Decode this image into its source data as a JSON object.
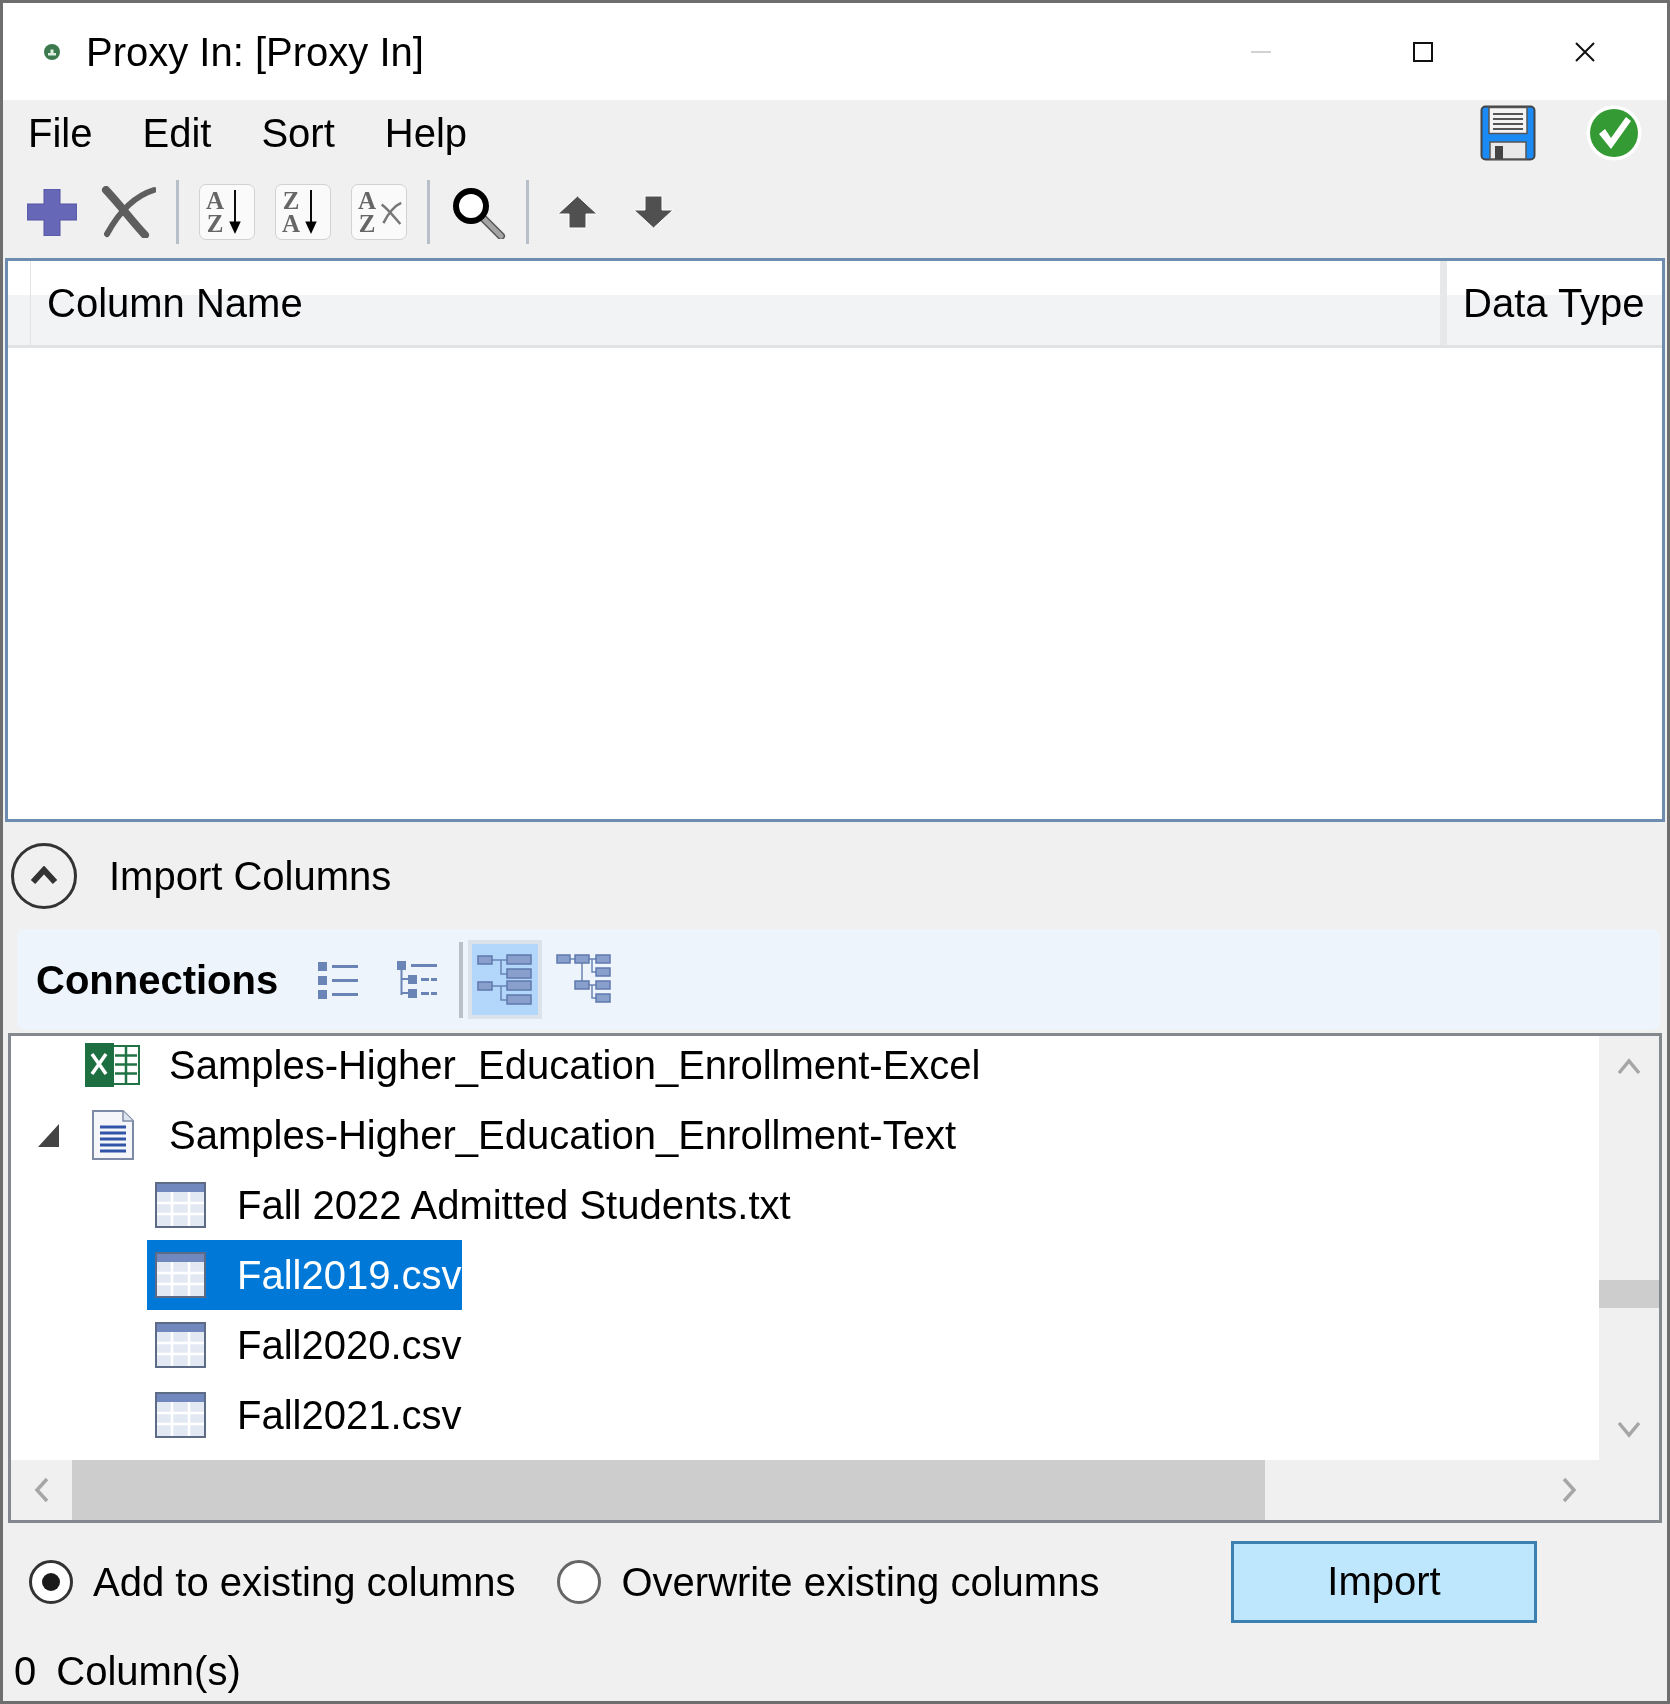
{
  "window": {
    "title": "Proxy In: [Proxy In]",
    "controls": [
      {
        "kind": "minimize",
        "disabled": true
      },
      {
        "kind": "maximize",
        "disabled": false
      },
      {
        "kind": "close",
        "disabled": false
      }
    ]
  },
  "menu": {
    "items": [
      "File",
      "Edit",
      "Sort",
      "Help"
    ],
    "actions": [
      {
        "kind": "save"
      },
      {
        "kind": "apply"
      }
    ]
  },
  "toolbar": [
    {
      "kind": "add"
    },
    {
      "kind": "delete"
    },
    {
      "kind": "separator"
    },
    {
      "kind": "sort",
      "letters": [
        "A",
        "Z"
      ]
    },
    {
      "kind": "sort",
      "letters": [
        "Z",
        "A"
      ]
    },
    {
      "kind": "clear_sort",
      "letters": [
        "A",
        "Z"
      ]
    },
    {
      "kind": "separator"
    },
    {
      "kind": "search"
    },
    {
      "kind": "separator"
    },
    {
      "kind": "move_up"
    },
    {
      "kind": "move_down"
    }
  ],
  "table": {
    "columns": [
      "Column Name",
      "Data Type"
    ]
  },
  "import_section": {
    "title": "Import Columns",
    "expanded": true
  },
  "connections": {
    "title": "Connections",
    "views": [
      {
        "kind": "list",
        "selected": false
      },
      {
        "kind": "indented_list",
        "selected": false
      },
      {
        "kind": "separator"
      },
      {
        "kind": "tree",
        "selected": true
      },
      {
        "kind": "tree_compact",
        "selected": false
      }
    ],
    "tree": [
      {
        "label": "Samples-Higher_Education_Enrollment-Excel",
        "kind": "excel",
        "selected": false
      },
      {
        "label": "Samples-Higher_Education_Enrollment-Text",
        "kind": "text",
        "selected": false,
        "expanded": true,
        "children": [
          {
            "label": "Fall 2022 Admitted Students.txt",
            "kind": "table",
            "selected": false
          },
          {
            "label": "Fall2019.csv",
            "kind": "table",
            "selected": true
          },
          {
            "label": "Fall2020.csv",
            "kind": "table",
            "selected": false
          },
          {
            "label": "Fall2021.csv",
            "kind": "table",
            "selected": false
          }
        ]
      }
    ]
  },
  "import_options": [
    {
      "label": "Add to existing columns",
      "selected": true
    },
    {
      "label": "Overwrite existing columns",
      "selected": false
    }
  ],
  "buttons": [
    "Import"
  ],
  "status_bar": {
    "count": "0",
    "label": "Column(s)"
  }
}
